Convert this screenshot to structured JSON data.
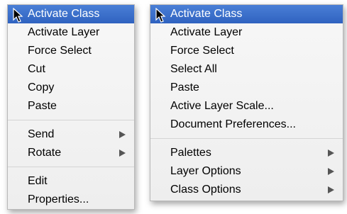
{
  "left_menu": {
    "items": [
      {
        "label": "Activate Class",
        "selected": true
      },
      {
        "label": "Activate Layer"
      },
      {
        "label": "Force Select"
      },
      {
        "label": "Cut"
      },
      {
        "label": "Copy"
      },
      {
        "label": "Paste"
      },
      {
        "label": "Send",
        "submenu": true
      },
      {
        "label": "Rotate",
        "submenu": true
      },
      {
        "label": "Edit"
      },
      {
        "label": "Properties..."
      }
    ]
  },
  "right_menu": {
    "items": [
      {
        "label": "Activate Class",
        "selected": true
      },
      {
        "label": "Activate Layer"
      },
      {
        "label": "Force Select"
      },
      {
        "label": "Select All"
      },
      {
        "label": "Paste"
      },
      {
        "label": "Active Layer Scale..."
      },
      {
        "label": "Document Preferences..."
      },
      {
        "label": "Palettes",
        "submenu": true
      },
      {
        "label": "Layer Options",
        "submenu": true
      },
      {
        "label": "Class Options",
        "submenu": true
      }
    ]
  },
  "colors": {
    "highlight": "#3a6dcc",
    "highlight_text": "#ffffff",
    "menu_background": "#f2f2f2"
  },
  "icons": [
    "mouse-pointer-icon",
    "submenu-arrow-icon"
  ]
}
